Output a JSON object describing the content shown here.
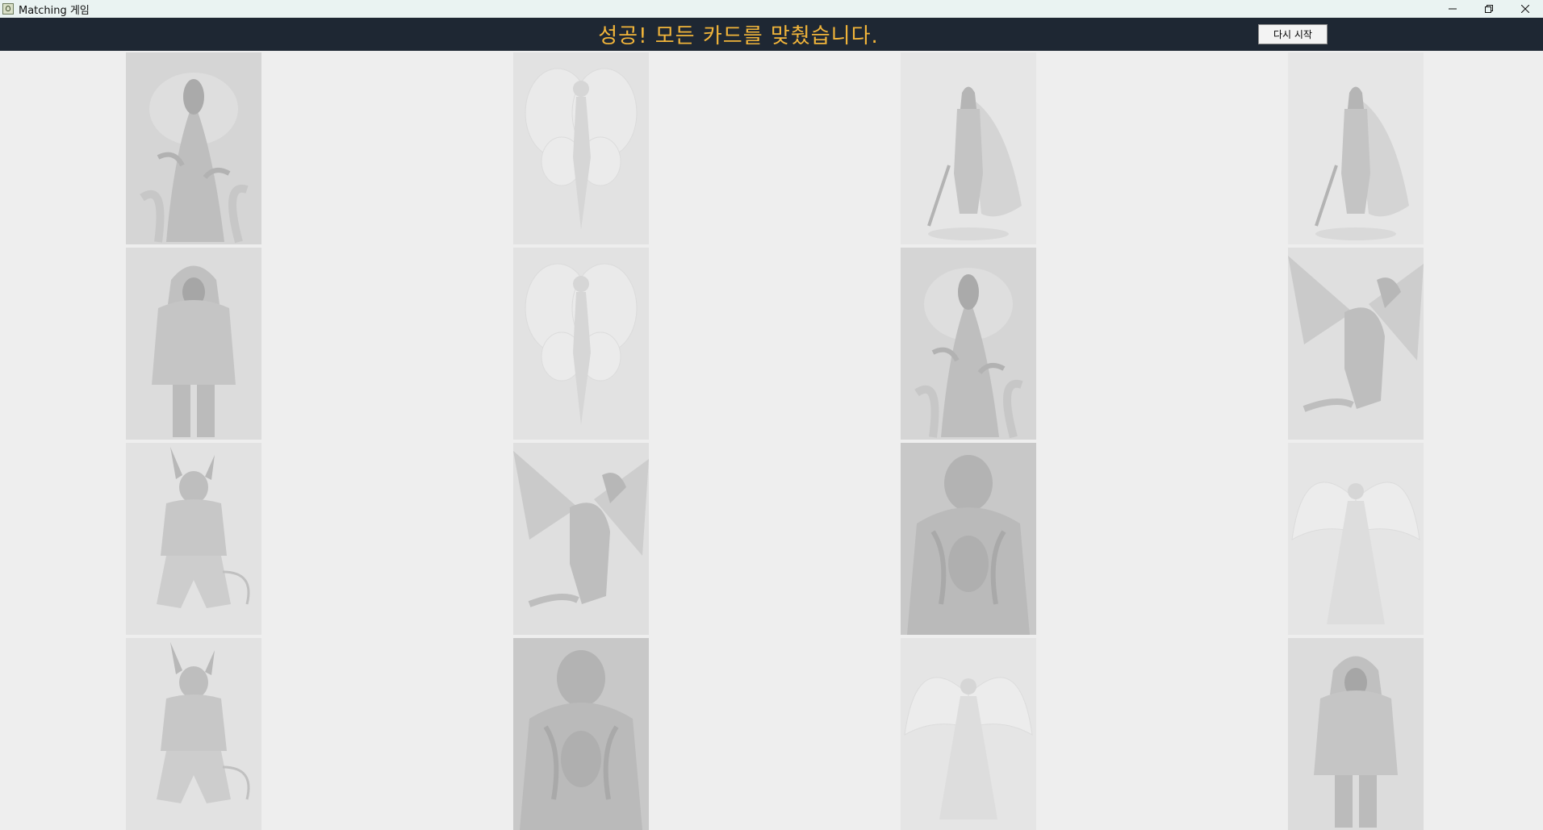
{
  "window": {
    "title": "Matching 게임"
  },
  "banner": {
    "message": "성공! 모든 카드를 맞췄습니다.",
    "restart_label": "다시 시작"
  },
  "colors": {
    "banner_bg": "#1e2733",
    "message": "#f2b53a",
    "board_bg": "#eeeeee"
  },
  "grid": {
    "rows": 4,
    "cols": 4,
    "cards": [
      [
        "wraith",
        "fairy",
        "knight",
        "knight"
      ],
      [
        "hoodie-figure",
        "fairy",
        "wraith",
        "dragon"
      ],
      [
        "demon-warrior",
        "dragon",
        "monster",
        "angel"
      ],
      [
        "demon-warrior",
        "monster",
        "angel",
        "hoodie-figure"
      ]
    ],
    "state": "all-matched"
  }
}
